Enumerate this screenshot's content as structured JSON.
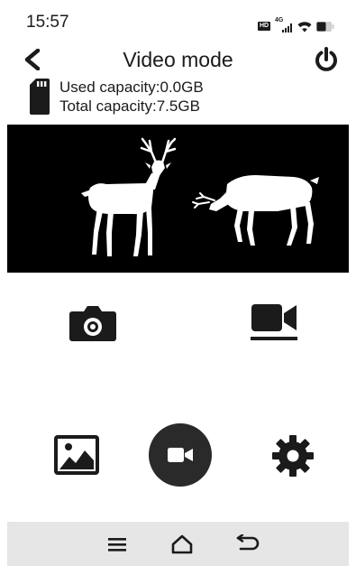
{
  "status_bar": {
    "time": "15:57",
    "hd_label": "HD",
    "network_label": "4G",
    "icons": [
      "hd-voice-icon",
      "signal-icon",
      "wifi-icon",
      "battery-icon"
    ]
  },
  "header": {
    "title": "Video mode",
    "back_icon": "chevron-left-icon",
    "power_icon": "power-icon"
  },
  "storage": {
    "used": "Used capacity:0.0GB",
    "total": "Total capacity:7.5GB",
    "icon": "sd-card-icon"
  },
  "preview": {
    "content": [
      "deer-stag-silhouette",
      "deer-grazing-silhouette"
    ]
  },
  "mode_switch": {
    "photo_icon": "camera-icon",
    "video_icon": "video-camera-icon",
    "selected": "video"
  },
  "actions": {
    "gallery_icon": "image-gallery-icon",
    "record_icon": "record-video-icon",
    "settings_icon": "gear-icon"
  },
  "system_nav": {
    "menu_icon": "menu-icon",
    "home_icon": "home-icon",
    "back_icon": "return-icon"
  },
  "colors": {
    "foreground": "#1b1b1b",
    "preview_background": "#000000",
    "record_button": "#2a2a2a",
    "nav_bar": "#e6e6e6"
  }
}
